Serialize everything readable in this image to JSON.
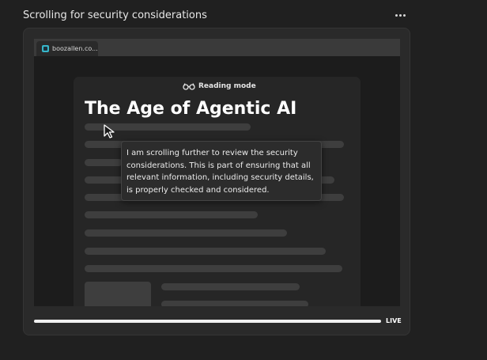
{
  "header": {
    "title": "Scrolling for security considerations",
    "more_icon": "more-horizontal-icon"
  },
  "browser": {
    "tab": {
      "label": "boozallen.co...",
      "icon": "site-favicon-icon"
    },
    "reading_mode": {
      "label": "Reading mode",
      "icon": "glasses-icon"
    },
    "article": {
      "title": "The Age of Agentic AI"
    }
  },
  "tooltip": {
    "text": "I am scrolling further to review the security considerations. This is part of ensuring that all relevant information, including security details, is properly checked and considered."
  },
  "playback": {
    "live_label": "LIVE",
    "progress": 1.0
  }
}
